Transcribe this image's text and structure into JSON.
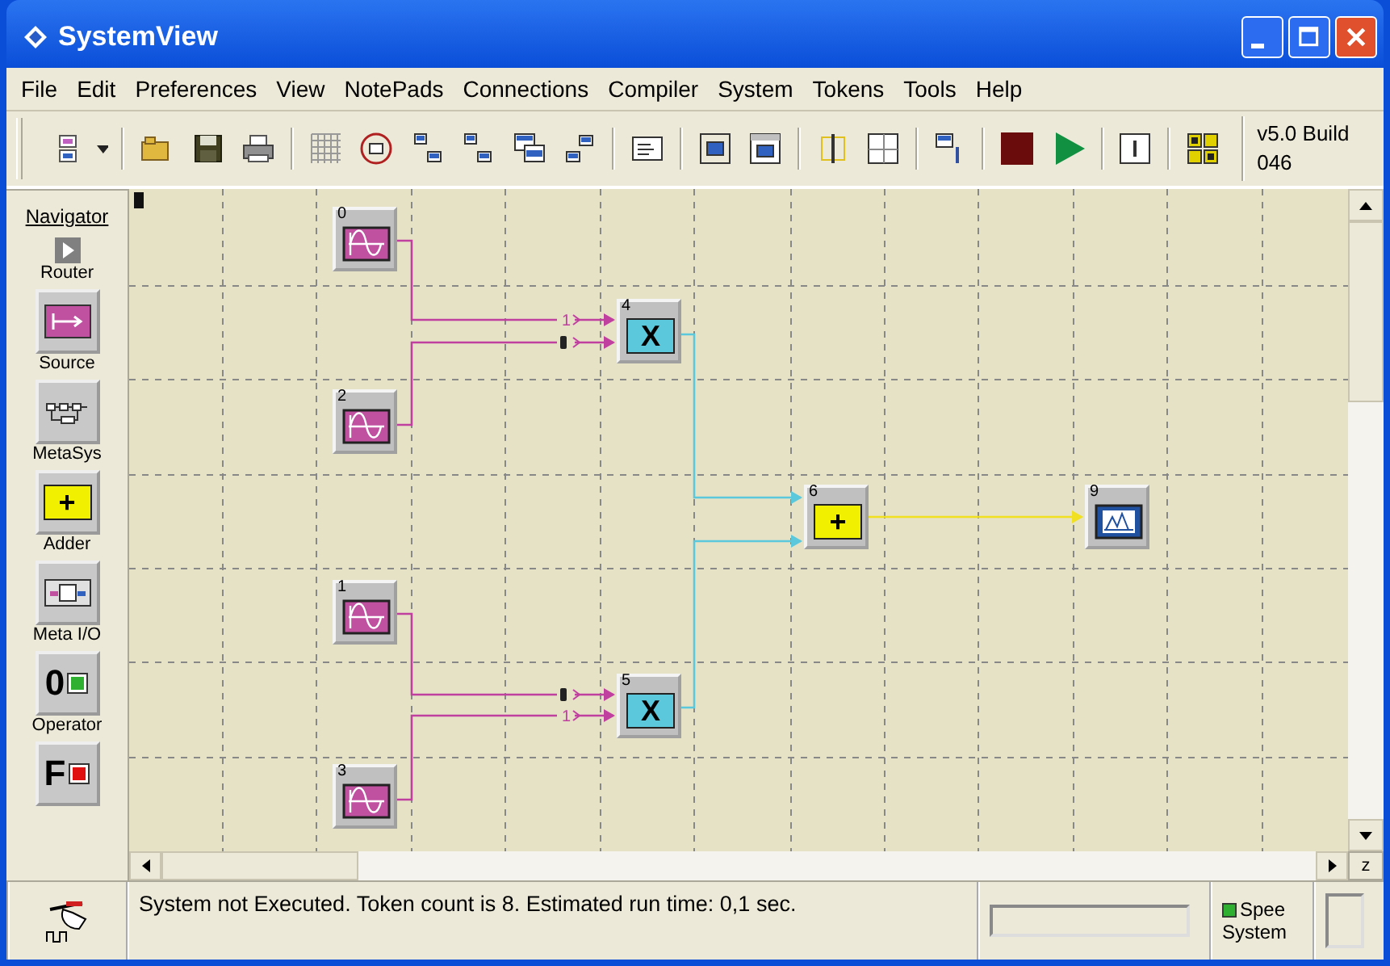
{
  "window": {
    "title": "SystemView"
  },
  "menu": [
    {
      "label": "File"
    },
    {
      "label": "Edit"
    },
    {
      "label": "Preferences"
    },
    {
      "label": "View"
    },
    {
      "label": "NotePads"
    },
    {
      "label": "Connections"
    },
    {
      "label": "Compiler"
    },
    {
      "label": "System"
    },
    {
      "label": "Tokens"
    },
    {
      "label": "Tools"
    },
    {
      "label": "Help"
    }
  ],
  "toolbar": {
    "version": "v5.0 Build 046"
  },
  "navigator": {
    "title": "Navigator",
    "items": [
      {
        "kind": "router",
        "label": "Router"
      },
      {
        "kind": "source",
        "label": "Source"
      },
      {
        "kind": "metasys",
        "label": "MetaSys"
      },
      {
        "kind": "adder",
        "label": "Adder",
        "symbol": "+"
      },
      {
        "kind": "metaio",
        "label": "Meta I/O"
      },
      {
        "kind": "operator",
        "label": "Operator",
        "symbol": "0"
      },
      {
        "kind": "function",
        "symbol": "F"
      }
    ]
  },
  "tokens": [
    {
      "number": "0",
      "kind": "source"
    },
    {
      "number": "2",
      "kind": "source"
    },
    {
      "number": "1",
      "kind": "source"
    },
    {
      "number": "3",
      "kind": "source"
    },
    {
      "number": "4",
      "kind": "multiplier",
      "symbol": "X"
    },
    {
      "number": "5",
      "kind": "multiplier",
      "symbol": "X"
    },
    {
      "number": "6",
      "kind": "adder",
      "symbol": "+"
    },
    {
      "number": "9",
      "kind": "sink"
    }
  ],
  "connections": [
    {
      "kind": "numbered",
      "label": "1"
    },
    {
      "kind": "marker"
    },
    {
      "kind": "marker"
    },
    {
      "kind": "numbered",
      "label": "1"
    },
    {
      "kind": "plain"
    },
    {
      "kind": "plain"
    },
    {
      "kind": "plain"
    }
  ],
  "scroll_corner": "z",
  "status_bar": {
    "message": "System not Executed. Token count is 8.  Estimated run time: 0,1 sec.",
    "speed_label": "Spee",
    "system_label": "System"
  }
}
